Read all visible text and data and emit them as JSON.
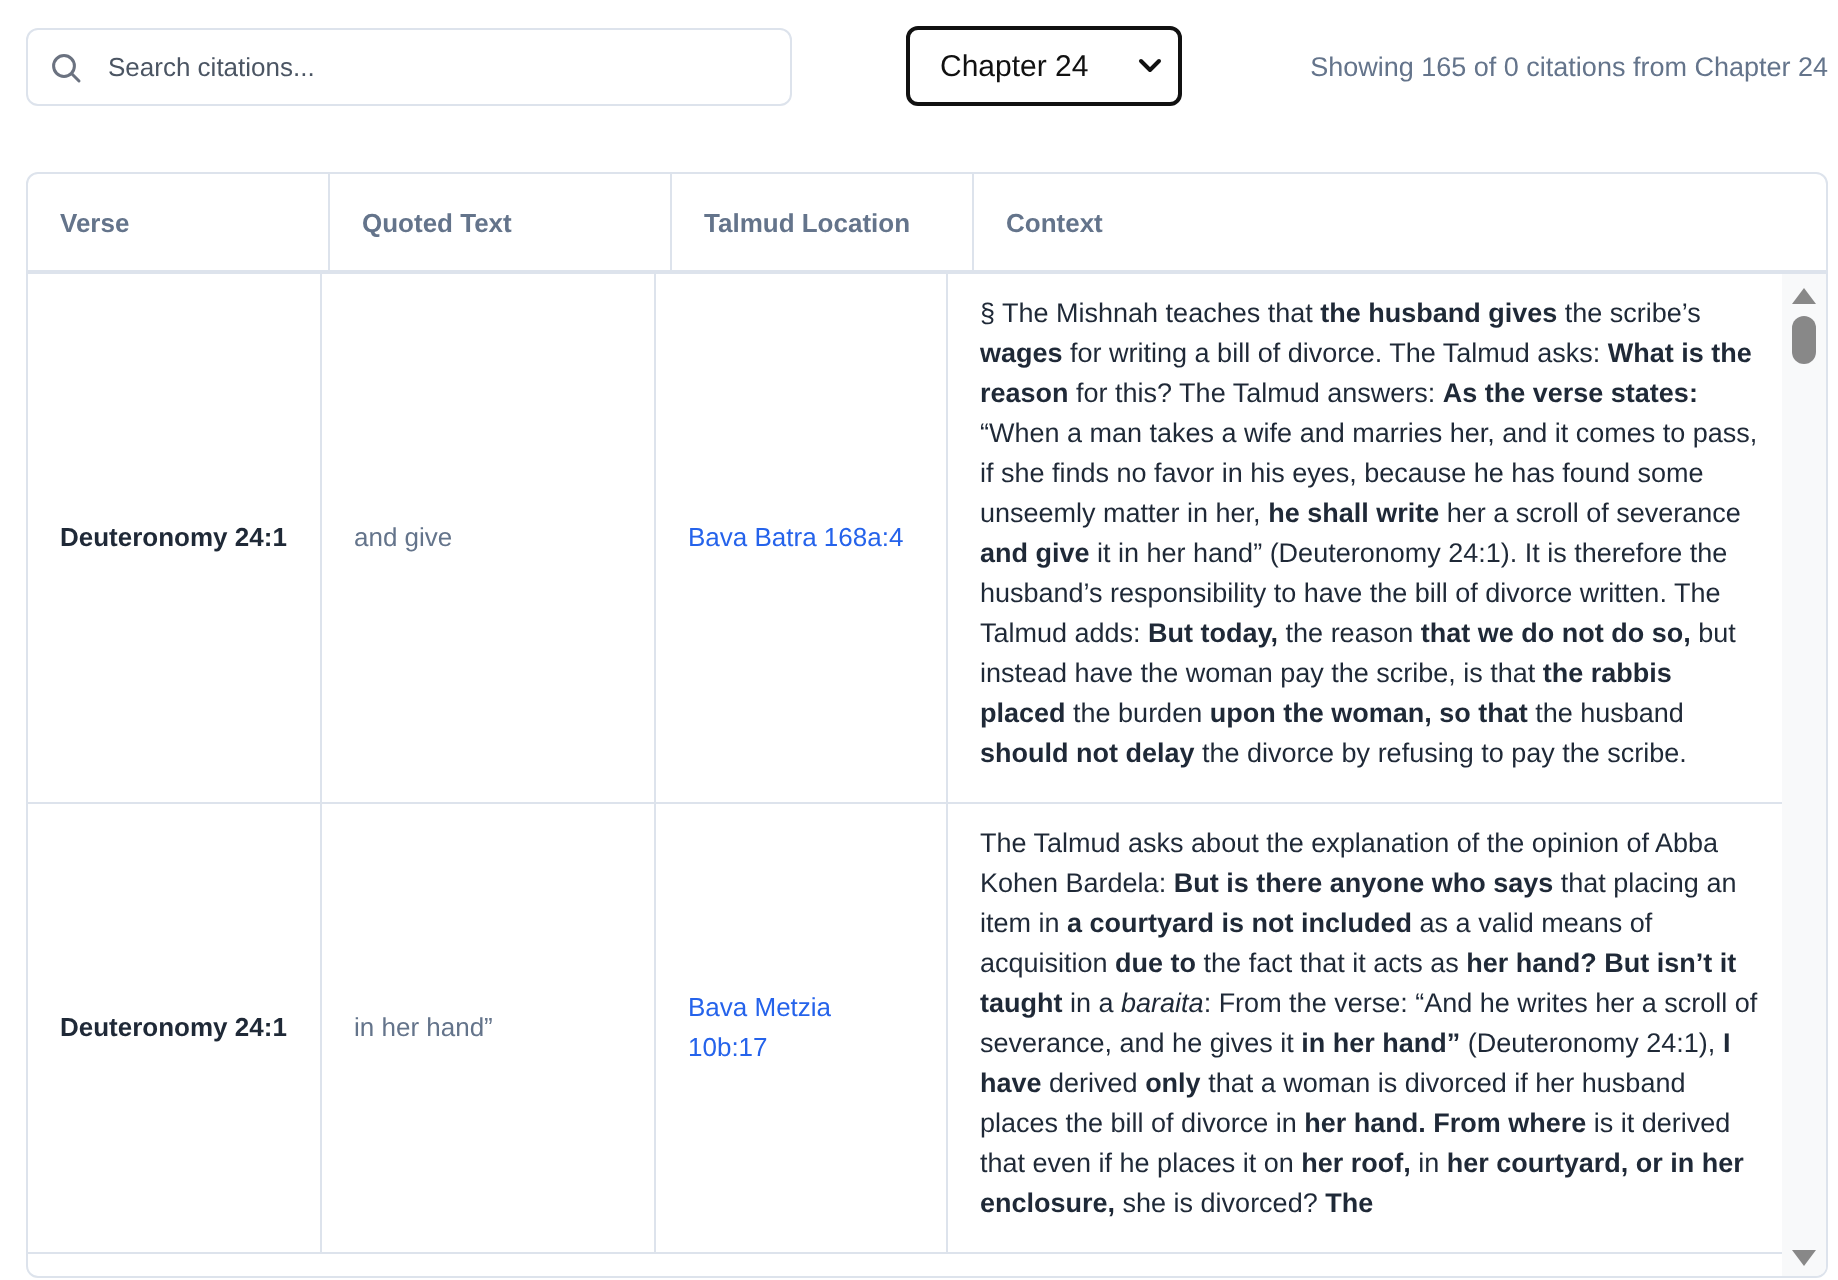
{
  "search": {
    "placeholder": "Search citations..."
  },
  "chapter_select": {
    "value": "Chapter 24"
  },
  "status": "Showing 165 of 0 citations from Chapter 24",
  "table": {
    "columns": [
      "Verse",
      "Quoted Text",
      "Talmud Location",
      "Context"
    ],
    "rows": [
      {
        "verse": "Deuteronomy 24:1",
        "quoted_text": "and give",
        "talmud_location": "Bava Batra 168a:4",
        "context": "§ The Mishnah teaches that **the husband gives** the scribe’s **wages** for writing a bill of divorce. The Talmud asks: **What is the reason** for this? The Talmud answers: **As the verse states:** “When a man takes a wife and marries her, and it comes to pass, if she finds no favor in his eyes, because he has found some unseemly matter in her, **he shall write** her a scroll of severance **and give** it in her hand” (Deuteronomy 24:1). It is therefore the husband’s responsibility to have the bill of divorce written. The Talmud adds: **But today,** the reason **that we do not do so,** but instead have the woman pay the scribe, is that **the rabbis placed** the burden **upon the woman, so that** the husband **should not delay** the divorce by refusing to pay the scribe."
      },
      {
        "verse": "Deuteronomy 24:1",
        "quoted_text": "in her hand”",
        "talmud_location": "Bava Metzia 10b:17",
        "context": "The Talmud asks about the explanation of the opinion of Abba Kohen Bardela: **But is there anyone who says** that placing an item in **a courtyard is not included** as a valid means of acquisition **due to** the fact that it acts as **her hand? But isn’t it taught** in a *baraita*: From the verse: “And he writes her a scroll of severance, and he gives it **in her hand”** (Deuteronomy 24:1), **I have** derived **only** that a woman is divorced if her husband places the bill of divorce in **her hand. From where** is it derived that even if he places it on **her roof,** in **her courtyard, or in her enclosure,** she is divorced? **The**"
      }
    ]
  }
}
